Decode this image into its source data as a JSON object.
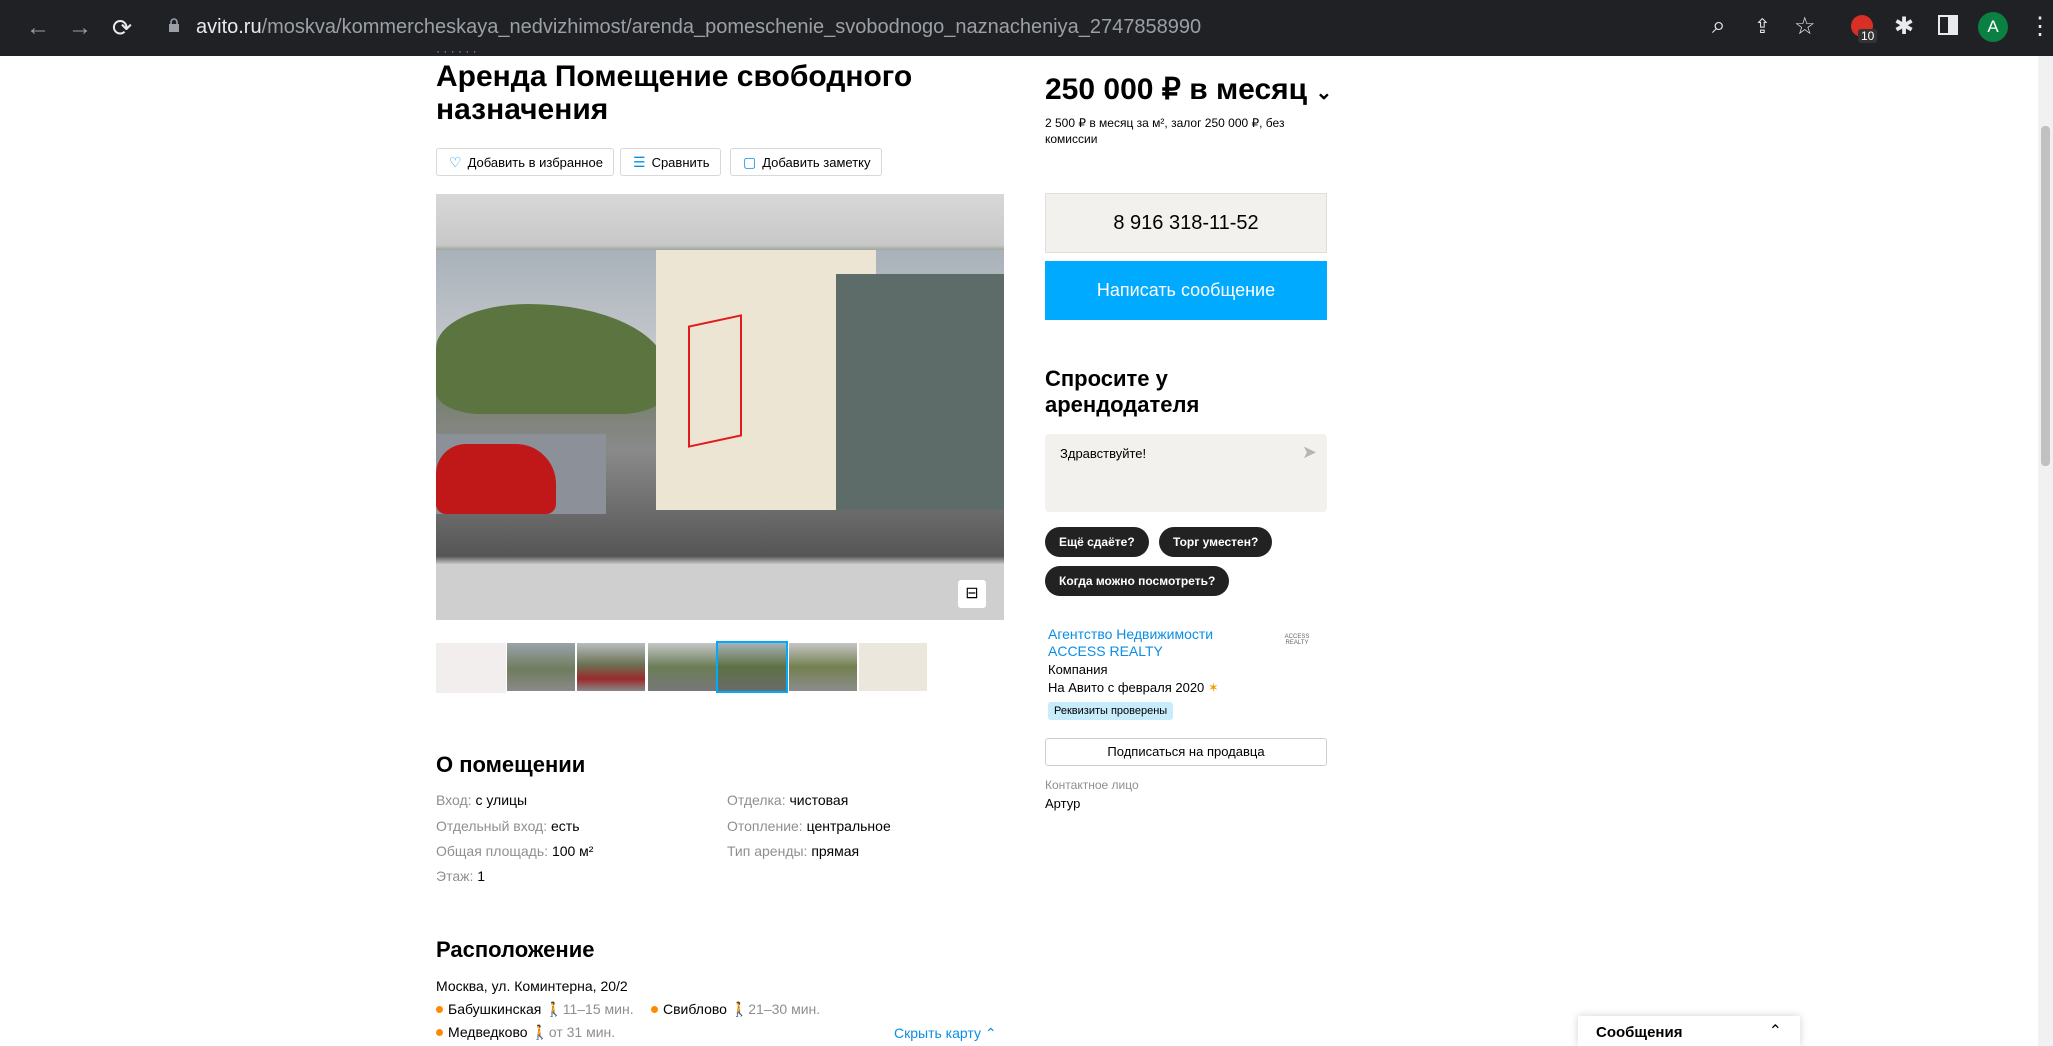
{
  "browser": {
    "url_host": "avito.ru",
    "url_path": "/moskva/kommercheskaya_nedvizhimost/arenda_pomeschenie_svobodnogo_naznacheniya_2747858990",
    "extension_badge": "10",
    "avatar_letter": "A"
  },
  "listing": {
    "title": "Аренда Помещение свободного назначения",
    "actions": [
      {
        "label": "Добавить в избранное",
        "icon": "heart-icon"
      },
      {
        "label": "Сравнить",
        "icon": "compare-icon"
      },
      {
        "label": "Добавить заметку",
        "icon": "note-icon"
      }
    ]
  },
  "about": {
    "heading": "О помещении",
    "params": [
      {
        "key": "Вход: ",
        "value": "с улицы"
      },
      {
        "key": "Отделка: ",
        "value": "чистовая"
      },
      {
        "key": "Отдельный вход: ",
        "value": "есть"
      },
      {
        "key": "Отопление: ",
        "value": "центральное"
      },
      {
        "key": "Общая площадь: ",
        "value": "100 м²"
      },
      {
        "key": "Тип аренды: ",
        "value": "прямая"
      },
      {
        "key": "Этаж: ",
        "value": "1"
      }
    ]
  },
  "location": {
    "heading": "Расположение",
    "address": "Москва, ул. Коминтерна, 20/2",
    "metro": [
      {
        "name": "Бабушкинская",
        "time": "11–15 мин."
      },
      {
        "name": "Свиблово",
        "time": "21–30 мин."
      },
      {
        "name": "Медведково",
        "time": "от 31 мин."
      }
    ],
    "hide_map": "Скрыть карту"
  },
  "price": {
    "main": "250 000 ₽ в месяц",
    "sub": "2 500 ₽ в месяц за м², залог 250 000 ₽, без комиссии"
  },
  "contact": {
    "phone": "8 916 318-11-52",
    "write_button": "Написать сообщение"
  },
  "ask": {
    "heading": "Спросите у арендодателя",
    "placeholder": "Здравствуйте!",
    "chips": [
      "Ещё сдаёте?",
      "Торг уместен?",
      "Когда можно посмотреть?"
    ]
  },
  "seller": {
    "name_line1": "Агентство Недвижимости",
    "name_line2": "ACCESS REALTY",
    "type": "Компания",
    "since": "На Авито с февраля 2020",
    "verified": "Реквизиты проверены",
    "subscribe": "Подписаться на продавца",
    "contact_label": "Контактное лицо",
    "contact_name": "Артур",
    "logo_text": "ACCESS REALTY"
  },
  "messages_panel": {
    "label": "Сообщения"
  }
}
